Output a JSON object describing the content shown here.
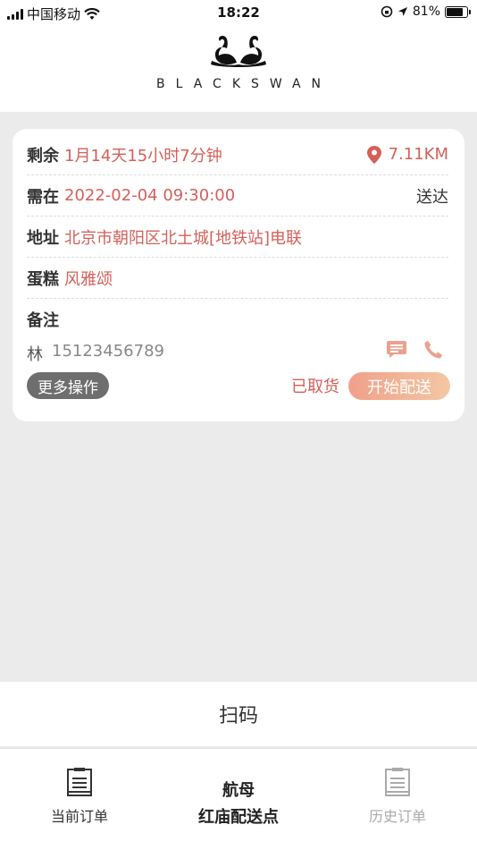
{
  "status_bar": {
    "carrier": "中国移动",
    "time": "18:22",
    "battery": "81%",
    "battery_level": 0.81
  },
  "header": {
    "brand": "BLACKSWAN"
  },
  "order": {
    "remaining_label": "剩余",
    "remaining_value": "1月14天15小时7分钟",
    "distance": "7.11KM",
    "due_label": "需在",
    "due_value": "2022-02-04 09:30:00",
    "delivery_type": "送达",
    "address_label": "地址",
    "address_value": "北京市朝阳区北土城[地铁站]电联",
    "cake_label": "蛋糕",
    "cake_value": "风雅颂",
    "remark_label": "备注",
    "contact_name": "林",
    "contact_phone": "15123456789",
    "more_label": "更多操作",
    "picked_label": "已取货",
    "start_label": "开始配送"
  },
  "scan": {
    "label": "扫码"
  },
  "tab_bar": {
    "current_label": "当前订单",
    "station_line1": "航母",
    "station_line2": "红庙配送点",
    "history_label": "历史订单"
  },
  "colors": {
    "accent": "#d4605a",
    "background": "#ebebeb"
  }
}
